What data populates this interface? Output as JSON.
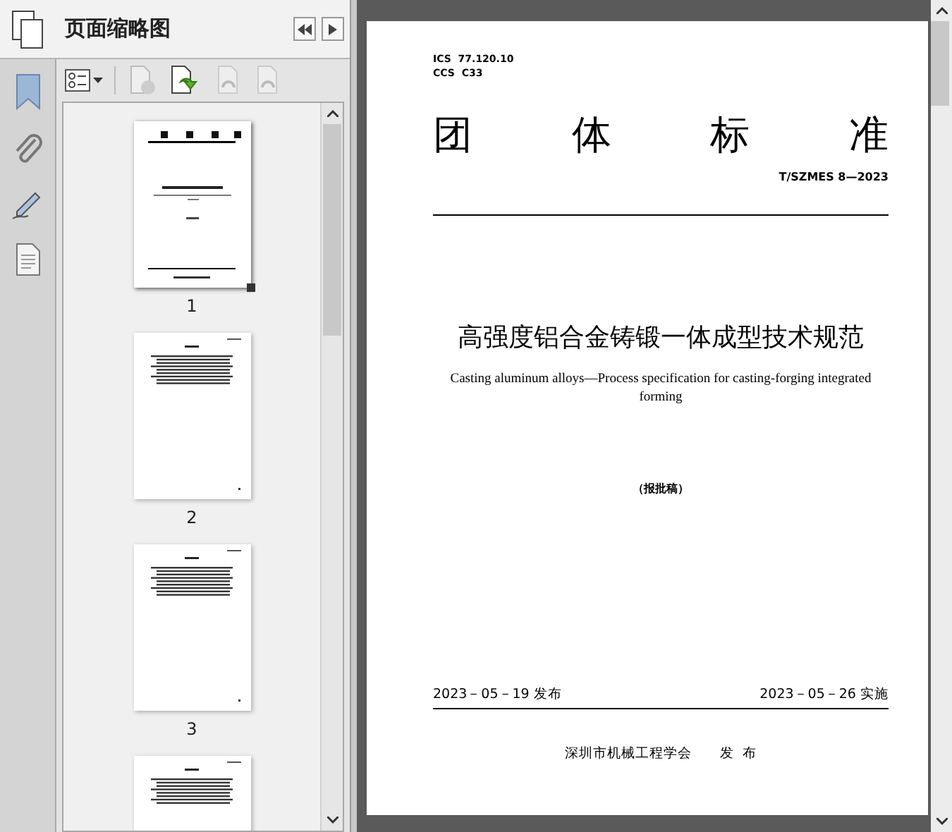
{
  "panel": {
    "title": "页面缩略图"
  },
  "thumbnails": [
    {
      "label": "1",
      "selected": true
    },
    {
      "label": "2",
      "selected": false
    },
    {
      "label": "3",
      "selected": false
    },
    {
      "selected": false
    }
  ],
  "document": {
    "ics": "ICS  77.120.10",
    "ccs": "CCS  C33",
    "heading": "团体标准",
    "code": "T/SZMES 8—2023",
    "title": "高强度铝合金铸锻一体成型技术规范",
    "subtitle": "Casting aluminum alloys—Process specification for casting-forging integrated forming",
    "stage": "（报批稿）",
    "issued": "2023－05－19 发布",
    "effective": "2023－05－26 实施",
    "publisher": "深圳市机械工程学会",
    "publish_word": "发  布"
  }
}
